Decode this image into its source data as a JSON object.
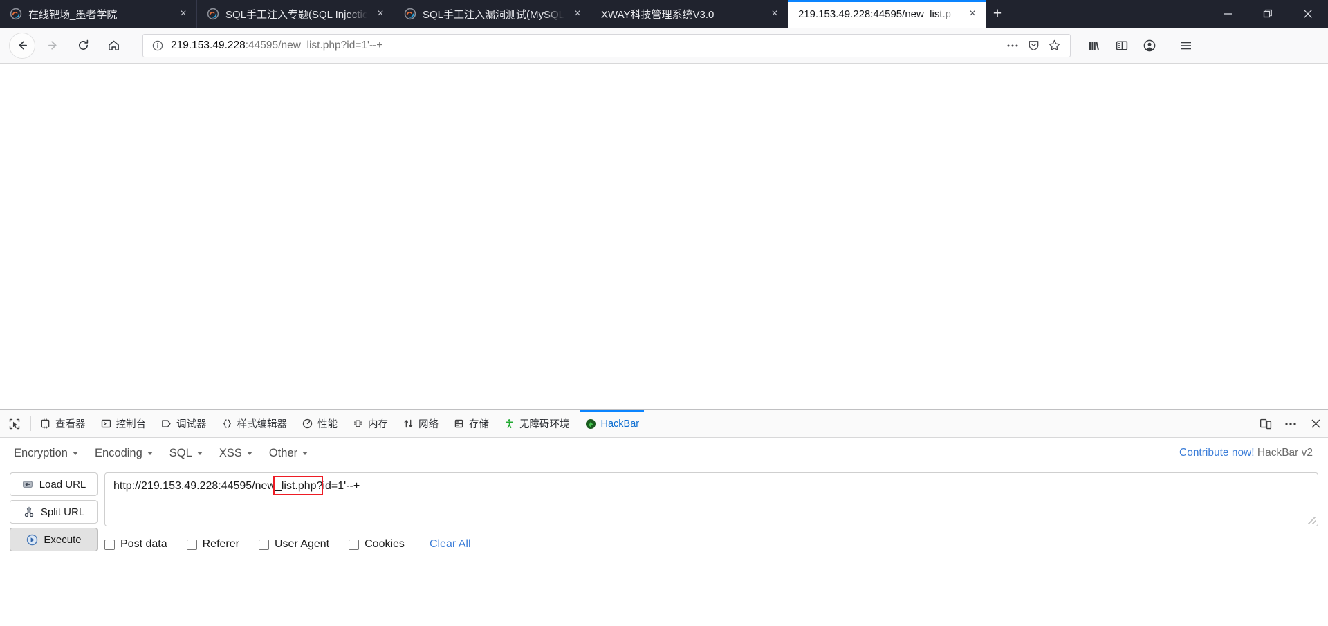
{
  "window": {
    "controls": {
      "minimize": "minimize-icon",
      "restore": "restore-icon",
      "close": "close-icon"
    }
  },
  "tabs": [
    {
      "title": "在线靶场_墨者学院",
      "favicon": "firefox-icon",
      "active": false,
      "close": "×"
    },
    {
      "title": "SQL手工注入专题(SQL Injection",
      "favicon": "firefox-icon",
      "active": false,
      "close": "×"
    },
    {
      "title": "SQL手工注入漏洞测试(MySQL",
      "favicon": "firefox-icon",
      "active": false,
      "close": "×"
    },
    {
      "title": "XWAY科技管理系统V3.0",
      "favicon": "none",
      "active": false,
      "close": "×"
    },
    {
      "title": "219.153.49.228:44595/new_list.p",
      "favicon": "none",
      "active": true,
      "close": "×"
    }
  ],
  "newtab_label": "+",
  "navbar": {
    "back": "back-arrow-icon",
    "forward": "forward-arrow-icon",
    "reload": "reload-icon",
    "home": "home-icon",
    "identity": "info-circle-icon",
    "url_host": "219.153.49.228",
    "url_rest": ":44595",
    "url_path": "/new_list.php?id=1'--+",
    "page_actions": "ellipsis-icon",
    "pocket": "pocket-shield-icon",
    "bookmark": "star-icon",
    "library": "library-icon",
    "sidebar": "sidebar-icon",
    "account": "account-icon",
    "appmenu": "hamburger-menu-icon"
  },
  "devtools": {
    "picker_icon": "element-picker-icon",
    "tabs": [
      {
        "label": "查看器",
        "icon": "inspector-icon",
        "active": false
      },
      {
        "label": "控制台",
        "icon": "console-icon",
        "active": false
      },
      {
        "label": "调试器",
        "icon": "debugger-icon",
        "active": false
      },
      {
        "label": "样式编辑器",
        "icon": "style-editor-icon",
        "active": false
      },
      {
        "label": "性能",
        "icon": "performance-icon",
        "active": false
      },
      {
        "label": "内存",
        "icon": "memory-icon",
        "active": false
      },
      {
        "label": "网络",
        "icon": "network-icon",
        "active": false
      },
      {
        "label": "存储",
        "icon": "storage-icon",
        "active": false
      },
      {
        "label": "无障碍环境",
        "icon": "accessibility-icon",
        "active": false
      },
      {
        "label": "HackBar",
        "icon": "hackbar-icon",
        "active": true
      }
    ],
    "responsive": "responsive-design-icon",
    "more": "ellipsis-icon",
    "close": "close-icon"
  },
  "hackbar": {
    "menus": [
      {
        "label": "Encryption"
      },
      {
        "label": "Encoding"
      },
      {
        "label": "SQL"
      },
      {
        "label": "XSS"
      },
      {
        "label": "Other"
      }
    ],
    "contribute": "Contribute now!",
    "version": "HackBar v2",
    "buttons": [
      {
        "label": "Load URL",
        "icon": "load-url-icon",
        "pressed": false
      },
      {
        "label": "Split URL",
        "icon": "split-url-icon",
        "pressed": false
      },
      {
        "label": "Execute",
        "icon": "execute-play-icon",
        "pressed": true
      }
    ],
    "url_value": "http://219.153.49.228:44595/new_list.php?id=1'--+",
    "url_placeholder": "",
    "options": [
      {
        "label": "Post data",
        "checked": false
      },
      {
        "label": "Referer",
        "checked": false
      },
      {
        "label": "User Agent",
        "checked": false
      },
      {
        "label": "Cookies",
        "checked": false
      }
    ],
    "clear_all": "Clear All",
    "annotation": {
      "color": "#ee1c25",
      "target": "?id=1'--+"
    }
  },
  "colors": {
    "titlebar": "#20232e",
    "accent": "#0a84ff",
    "link": "#3b7dd8",
    "annotation": "#ee1c25",
    "toolbar_bg": "#f9f9fa"
  }
}
